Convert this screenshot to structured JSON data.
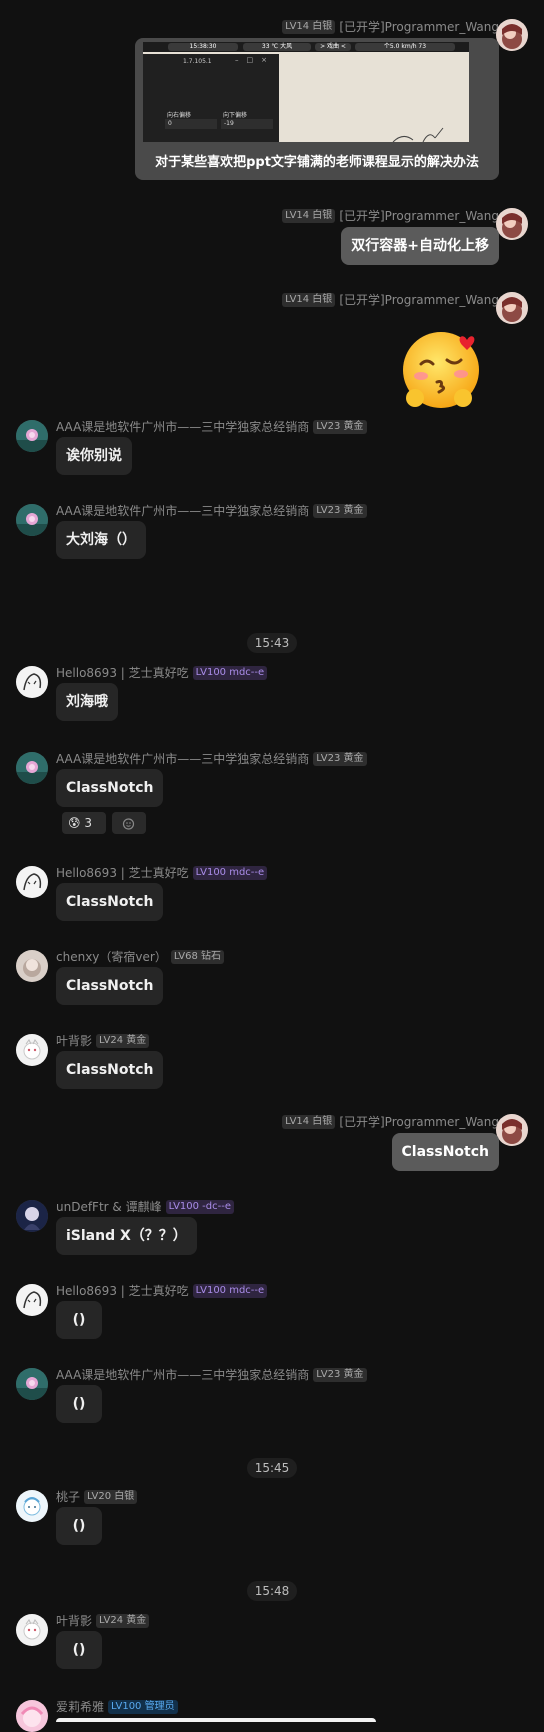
{
  "image_message": {
    "level": "LV14 白银",
    "sender": "[已开学]Programmer_Wang",
    "caption": "对于某些喜欢把ppt文字铺满的老师课程显示的解决办法",
    "screenshot": {
      "clock": "15:38:30",
      "weather": "33 ℃ 大风",
      "media": "> 戏曲 <",
      "status": "个5.0 km/h  73",
      "version": "1.7.105.1",
      "left_label": "向右偏移",
      "left_value": "0",
      "down_label": "向下偏移",
      "down_value": "-19"
    }
  },
  "messages": [
    {
      "level": "LV14 白银",
      "sender": "[已开学]Programmer_Wang",
      "text": "双行容器+自动化上移"
    },
    {
      "level": "LV14 白银",
      "sender": "[已开学]Programmer_Wang",
      "sticker": "kiss-wink-emoji"
    },
    {
      "sender": "AAA课是地软件广州市——三中学独家总经销商",
      "level": "LV23 黄金",
      "text": "诶你别说"
    },
    {
      "sender": "AAA课是地软件广州市——三中学独家总经销商",
      "level": "LV23 黄金",
      "text": "大刘海（）"
    },
    {
      "time": "15:43"
    },
    {
      "sender": "Hello8693 | 芝士真好吃",
      "level": "LV100 mdc--e",
      "text": "刘海哦"
    },
    {
      "sender": "AAA课是地软件广州市——三中学独家总经销商",
      "level": "LV23 黄金",
      "text": "ClassNotch",
      "reaction_emoji": "😰",
      "reaction_count": "3"
    },
    {
      "sender": "Hello8693 | 芝士真好吃",
      "level": "LV100 mdc--e",
      "text": "ClassNotch"
    },
    {
      "sender": "chenxy（寄宿ver）",
      "level": "LV68 钻石",
      "text": "ClassNotch"
    },
    {
      "sender": "叶背影",
      "level": "LV24 黄金",
      "text": "ClassNotch"
    },
    {
      "level": "LV14 白银",
      "sender": "[已开学]Programmer_Wang",
      "text": "ClassNotch"
    },
    {
      "sender": "unDefFtr & 谭麒峰",
      "level": "LV100 -dc--e",
      "text": "iSland X（？？）"
    },
    {
      "sender": "Hello8693 | 芝士真好吃",
      "level": "LV100 mdc--e",
      "text": "()"
    },
    {
      "sender": "AAA课是地软件广州市——三中学独家总经销商",
      "level": "LV23 黄金",
      "text": "()"
    },
    {
      "time": "15:45"
    },
    {
      "sender": "桃子",
      "level": "LV20 白银",
      "text": "()"
    },
    {
      "time": "15:48"
    },
    {
      "sender": "叶背影",
      "level": "LV24 黄金",
      "text": "()"
    },
    {
      "sender": "爱莉希雅",
      "level": "LV100 管理员"
    }
  ]
}
